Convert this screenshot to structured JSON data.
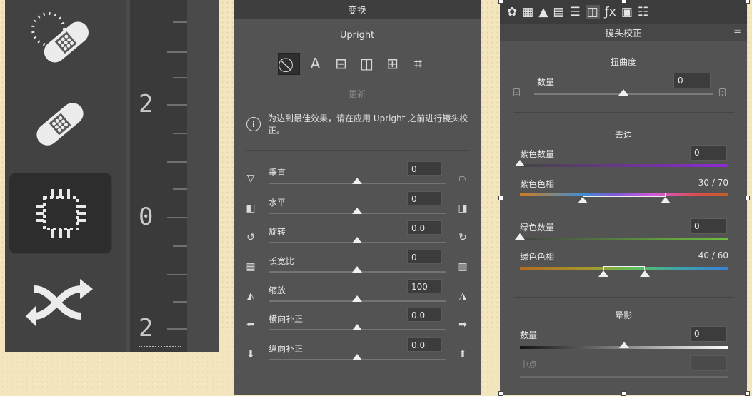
{
  "left_tools": {
    "tools": [
      {
        "icon": "healing-brush-dotted-icon"
      },
      {
        "icon": "healing-brush-icon"
      },
      {
        "icon": "content-aware-patch-icon",
        "active": true
      },
      {
        "icon": "content-aware-move-icon"
      }
    ],
    "ruler": {
      "labels": [
        "2",
        "0",
        "2"
      ]
    }
  },
  "transform": {
    "header": "变换",
    "upright_label": "Upright",
    "upright_buttons": [
      {
        "icon": "off-icon",
        "glyph": "⃠",
        "active": true
      },
      {
        "icon": "auto-icon",
        "glyph": "A"
      },
      {
        "icon": "level-icon",
        "glyph": "⊟"
      },
      {
        "icon": "vertical-icon",
        "glyph": "◫"
      },
      {
        "icon": "full-icon",
        "glyph": "⊞"
      },
      {
        "icon": "guided-icon",
        "glyph": "⌗"
      }
    ],
    "update_link": "更新",
    "info_text": "为达到最佳效果，请在应用 Upright 之前进行镜头校正。",
    "sliders": [
      {
        "label": "垂直",
        "value": "0",
        "pos": 0.5,
        "left_icon": "▽",
        "right_icon": "⏢"
      },
      {
        "label": "水平",
        "value": "0",
        "pos": 0.5,
        "left_icon": "◧",
        "right_icon": "◨"
      },
      {
        "label": "旋转",
        "value": "0.0",
        "pos": 0.5,
        "left_icon": "↺",
        "right_icon": "↻"
      },
      {
        "label": "长宽比",
        "value": "0",
        "pos": 0.5,
        "left_icon": "▦",
        "right_icon": "▥"
      },
      {
        "label": "缩放",
        "value": "100",
        "pos": 0.5,
        "left_icon": "◭",
        "right_icon": "◮"
      },
      {
        "label": "横向补正",
        "value": "0.0",
        "pos": 0.5,
        "left_icon": "⬅",
        "right_icon": "➡"
      },
      {
        "label": "纵向补正",
        "value": "0.0",
        "pos": 0.5,
        "left_icon": "⬇",
        "right_icon": "⬆"
      }
    ]
  },
  "lens": {
    "tabs": [
      {
        "icon": "aperture-icon",
        "glyph": "✿"
      },
      {
        "icon": "grid-icon",
        "glyph": "▦"
      },
      {
        "icon": "mountain-icon",
        "glyph": "▲"
      },
      {
        "icon": "hsl-icon",
        "glyph": "▤"
      },
      {
        "icon": "split-toning-icon",
        "glyph": "☰"
      },
      {
        "icon": "lens-icon",
        "glyph": "◫",
        "active": true
      },
      {
        "icon": "fx-icon",
        "glyph": "ƒx"
      },
      {
        "icon": "camera-calibration-icon",
        "glyph": "▣"
      },
      {
        "icon": "presets-icon",
        "glyph": "☷"
      }
    ],
    "title": "镜头校正",
    "distortion": {
      "heading": "扭曲度",
      "amount_label": "数量",
      "amount_value": "0",
      "pos": 0.5
    },
    "defringe": {
      "heading": "去边",
      "purple_amount_label": "紫色数量",
      "purple_amount_value": "0",
      "purple_amount_pos": 0,
      "purple_hue_label": "紫色色相",
      "purple_hue_value": "30 / 70",
      "purple_hue_range": [
        30,
        70
      ],
      "green_amount_label": "绿色数量",
      "green_amount_value": "0",
      "green_amount_pos": 0,
      "green_hue_label": "绿色色相",
      "green_hue_value": "40 / 60",
      "green_hue_range": [
        40,
        60
      ]
    },
    "vignette": {
      "heading": "晕影",
      "amount_label": "数量",
      "amount_value": "0",
      "pos": 0.5,
      "midpoint_label": "中点",
      "midpoint_value": ""
    }
  }
}
